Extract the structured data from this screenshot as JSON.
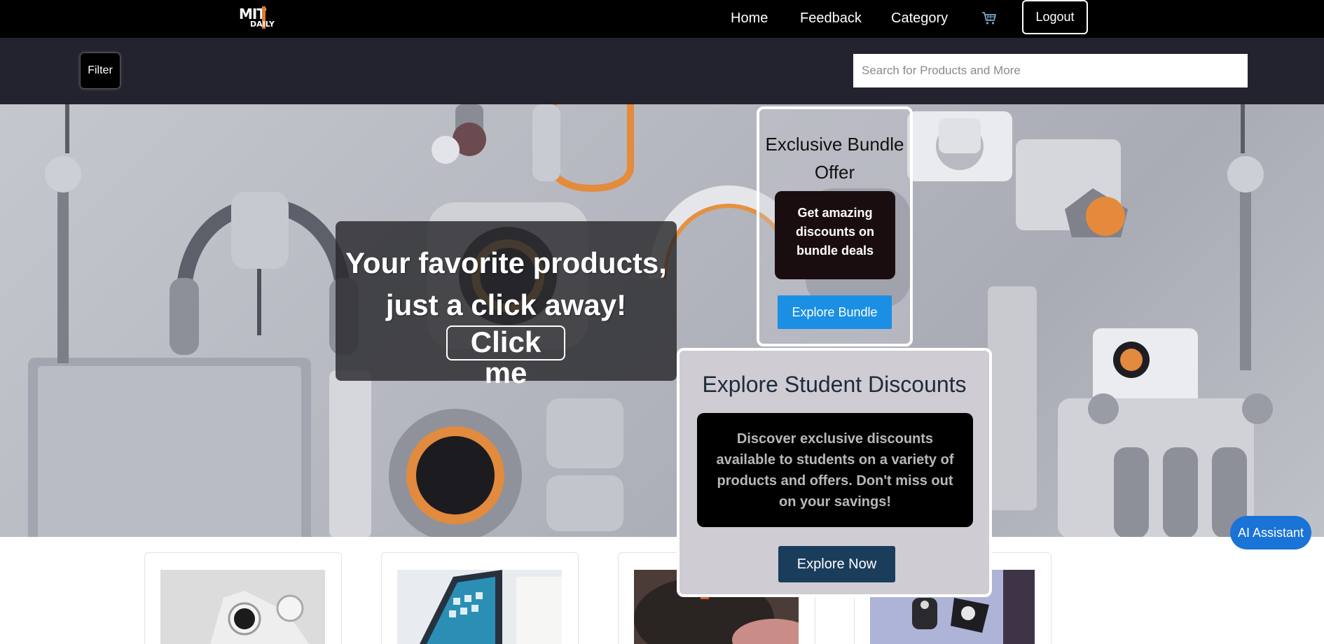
{
  "nav": {
    "logo_top": "MIT",
    "logo_bottom": "DAILY",
    "links": [
      "Home",
      "Feedback",
      "Category"
    ],
    "cart_icon": "shopping-cart-icon",
    "logout_label": "Logout"
  },
  "toolbar": {
    "filter_label": "Filter",
    "search_placeholder": "Search for Products and More"
  },
  "hero": {
    "title": "Your favorite products, just a click away!",
    "button_label": "Click me"
  },
  "bundle": {
    "title": "Exclusive Bundle Offer",
    "description": "Get amazing discounts on bundle deals",
    "button_label": "Explore Bundle"
  },
  "student": {
    "title": "Explore Student Discounts",
    "description": "Discover exclusive discounts available to students on a variety of products and offers. Don't miss out on your savings!",
    "button_label": "Explore Now"
  },
  "assistant": {
    "label": "AI Assistant"
  },
  "colors": {
    "nav_bg": "#000000",
    "toolbar_bg": "#23222f",
    "accent_blue": "#1a8fe3",
    "student_button": "#1b3d5c",
    "logo_accent": "#e07a2f"
  }
}
